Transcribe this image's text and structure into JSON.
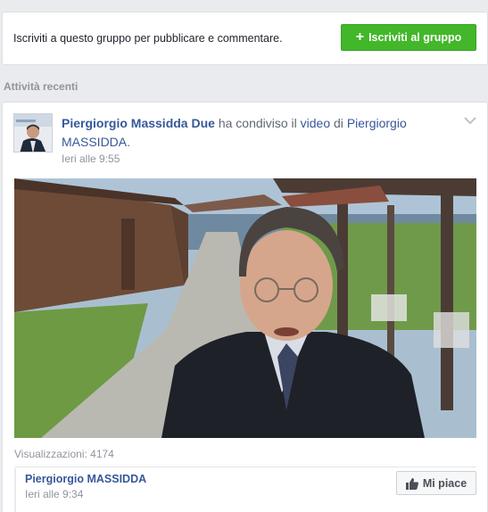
{
  "join": {
    "text": "Iscriviti a questo gruppo per pubblicare e commentare.",
    "button_label": "Iscriviti al gruppo",
    "button_icon": "plus-icon",
    "button_color": "#42b72a"
  },
  "section": {
    "title": "Attività recenti"
  },
  "post": {
    "author": "Piergiorgio Massidda Due",
    "action": "ha condiviso il",
    "object": "video",
    "preposition": "di",
    "original_author": "Piergiorgio MASSIDDA",
    "period": ".",
    "time": "Ieri alle 9:55",
    "views": "Visualizzazioni: 4174",
    "link_color": "#365899"
  },
  "shared": {
    "name": "Piergiorgio MASSIDDA",
    "time": "Ieri alle 9:34",
    "like_label": "Mi piace",
    "like_icon": "thumbs-up-icon"
  }
}
